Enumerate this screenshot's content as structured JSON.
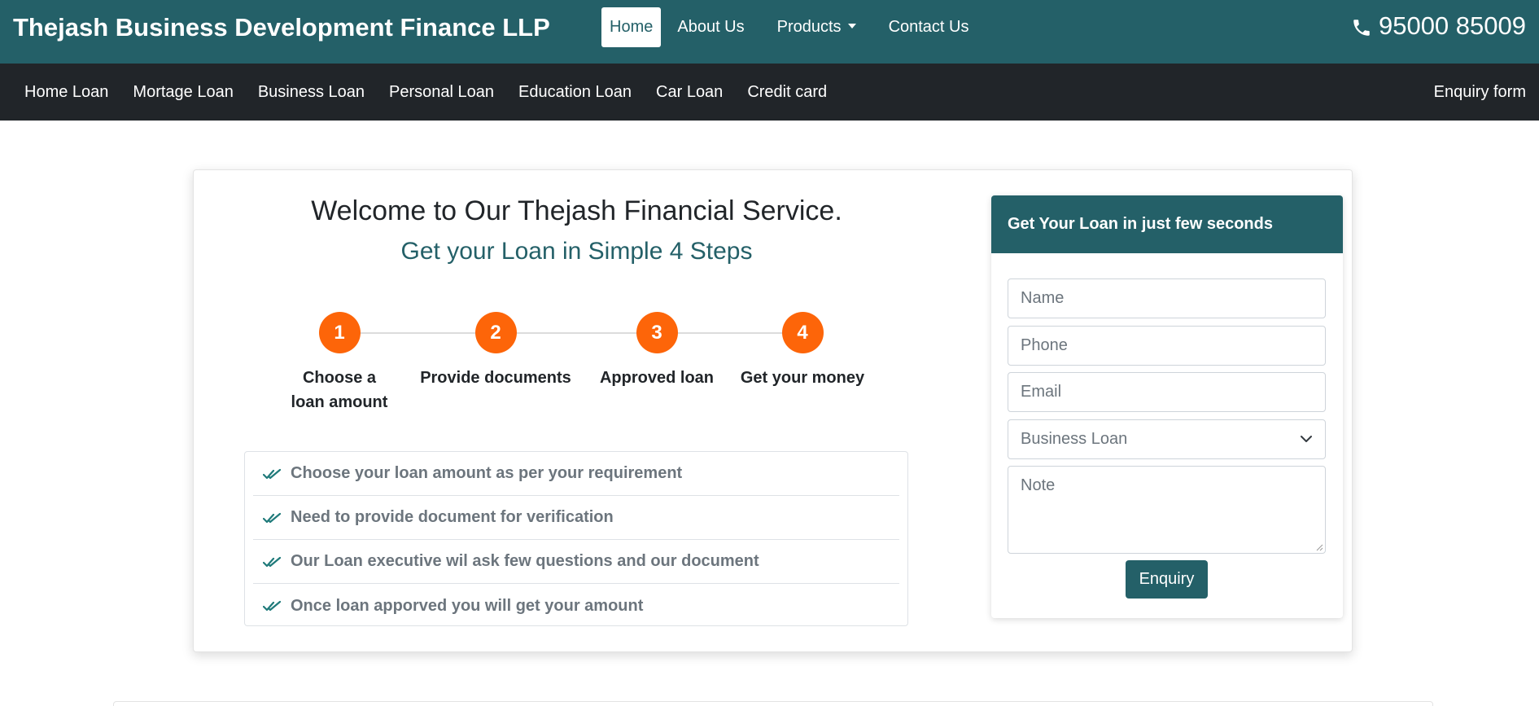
{
  "topbar": {
    "brand": "Thejash Business Development Finance LLP",
    "nav": [
      {
        "label": "Home",
        "active": true
      },
      {
        "label": "About Us"
      },
      {
        "label": "Products",
        "dropdown": true
      },
      {
        "label": "Contact Us"
      }
    ],
    "phone_icon": "phone-icon",
    "phone": "95000 85009"
  },
  "subnav": {
    "items": [
      "Home Loan",
      "Mortage Loan",
      "Business Loan",
      "Personal Loan",
      "Education Loan",
      "Car Loan",
      "Credit card"
    ],
    "right_link": "Enquiry form"
  },
  "hero": {
    "title": "Welcome to Our Thejash Financial Service.",
    "subtitle": "Get your Loan in Simple 4 Steps"
  },
  "steps": [
    {
      "number": "1",
      "label": "Choose a loan amount"
    },
    {
      "number": "2",
      "label": "Provide documents"
    },
    {
      "number": "3",
      "label": "Approved loan"
    },
    {
      "number": "4",
      "label": "Get your money"
    }
  ],
  "checklist": {
    "icon": "double-check-icon",
    "items": [
      "Choose your loan amount as per your requirement",
      "Need to provide document for verification",
      "Our Loan executive wil ask few questions and our document",
      "Once loan apporved you will get your amount"
    ]
  },
  "form": {
    "header": "Get Your Loan in just few seconds",
    "name_placeholder": "Name",
    "phone_placeholder": "Phone",
    "email_placeholder": "Email",
    "loan_type_selected": "Business Loan",
    "note_placeholder": "Note",
    "submit_label": "Enquiry"
  },
  "colors": {
    "brand_teal": "#246068",
    "dark_nav": "#212529",
    "step_orange": "#fd6509"
  }
}
